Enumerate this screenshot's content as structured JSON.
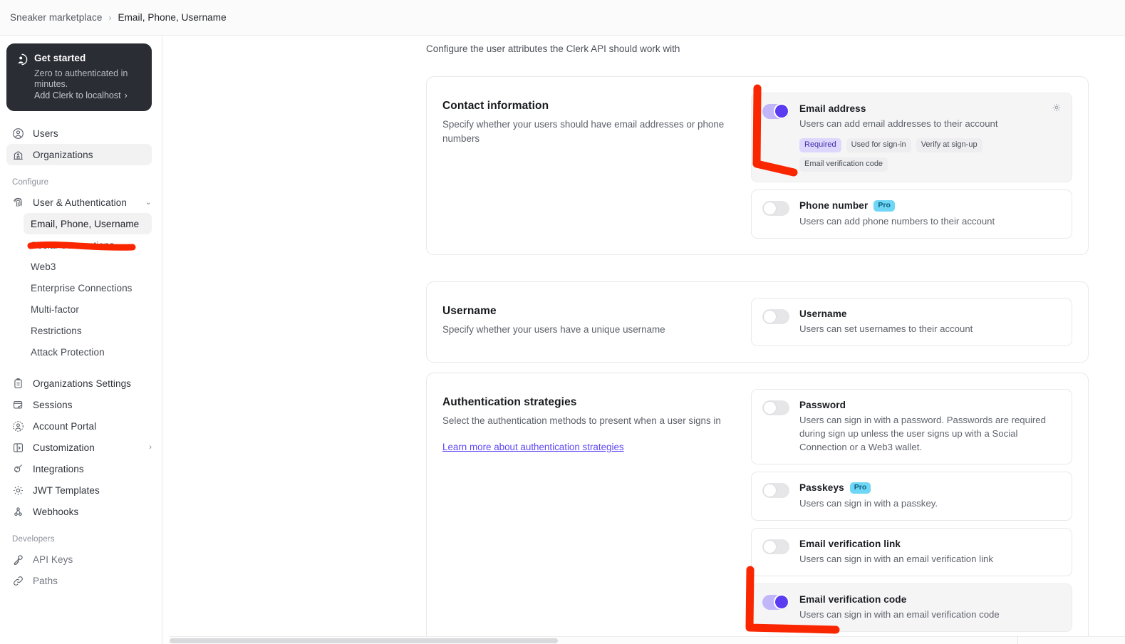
{
  "breadcrumb": {
    "app": "Sneaker marketplace",
    "separator": "›",
    "current": "Email, Phone, Username"
  },
  "sidebar": {
    "get_started": {
      "icon": "user-circle-icon",
      "title": "Get started",
      "subtitle": "Zero to authenticated in minutes.",
      "link": "Add Clerk to localhost",
      "link_chevron": "›"
    },
    "top_items": [
      {
        "icon": "users-icon",
        "label": "Users",
        "active": false
      },
      {
        "icon": "organizations-icon",
        "label": "Organizations",
        "active": true
      }
    ],
    "configure_label": "Configure",
    "configure_group": {
      "icon": "fingerprint-icon",
      "label": "User & Authentication",
      "chevron": "⌄"
    },
    "configure_subitems": [
      {
        "label": "Email, Phone, Username",
        "active": true
      },
      {
        "label": "Social Connections",
        "active": false
      },
      {
        "label": "Web3",
        "active": false
      },
      {
        "label": "Enterprise Connections",
        "active": false
      },
      {
        "label": "Multi-factor",
        "active": false
      },
      {
        "label": "Restrictions",
        "active": false
      },
      {
        "label": "Attack Protection",
        "active": false
      }
    ],
    "configure_items": [
      {
        "icon": "clipboard-icon",
        "label": "Organizations Settings",
        "chevron": ""
      },
      {
        "icon": "sessions-icon",
        "label": "Sessions",
        "chevron": ""
      },
      {
        "icon": "account-portal-icon",
        "label": "Account Portal",
        "chevron": ""
      },
      {
        "icon": "customization-icon",
        "label": "Customization",
        "chevron": "›"
      },
      {
        "icon": "plug-icon",
        "label": "Integrations",
        "chevron": ""
      },
      {
        "icon": "gear-icon",
        "label": "JWT Templates",
        "chevron": ""
      },
      {
        "icon": "webhooks-icon",
        "label": "Webhooks",
        "chevron": ""
      }
    ],
    "developers_label": "Developers",
    "developer_items": [
      {
        "icon": "key-icon",
        "label": "API Keys"
      },
      {
        "icon": "paths-icon",
        "label": "Paths"
      }
    ]
  },
  "main": {
    "intro": "Configure the user attributes the Clerk API should work with",
    "cards": [
      {
        "title": "Contact information",
        "description": "Specify whether your users should have email addresses or phone numbers",
        "link": "",
        "options": [
          {
            "label": "Email address",
            "description": "Users can add email addresses to their account",
            "enabled": true,
            "pro": false,
            "gear": true,
            "chips": [
              {
                "text": "Required",
                "primary": true
              },
              {
                "text": "Used for sign-in",
                "primary": false
              },
              {
                "text": "Verify at sign-up",
                "primary": false
              },
              {
                "text": "Email verification code",
                "primary": false
              }
            ]
          },
          {
            "label": "Phone number",
            "description": "Users can add phone numbers to their account",
            "enabled": false,
            "pro": true,
            "pro_label": "Pro",
            "gear": false,
            "chips": []
          }
        ]
      },
      {
        "title": "Username",
        "description": "Specify whether your users have a unique username",
        "link": "",
        "options": [
          {
            "label": "Username",
            "description": "Users can set usernames to their account",
            "enabled": false,
            "pro": false,
            "gear": false,
            "chips": []
          }
        ]
      },
      {
        "title": "Authentication strategies",
        "description": "Select the authentication methods to present when a user signs in",
        "link": "Learn more about authentication strategies",
        "options": [
          {
            "label": "Password",
            "description": "Users can sign in with a password. Passwords are required during sign up unless the user signs up with a Social Connection or a Web3 wallet.",
            "enabled": false,
            "pro": false,
            "gear": false,
            "chips": []
          },
          {
            "label": "Passkeys",
            "description": "Users can sign in with a passkey.",
            "enabled": false,
            "pro": true,
            "pro_label": "Pro",
            "gear": false,
            "chips": []
          },
          {
            "label": "Email verification link",
            "description": "Users can sign in with an email verification link",
            "enabled": false,
            "pro": false,
            "gear": false,
            "chips": []
          },
          {
            "label": "Email verification code",
            "description": "Users can sign in with an email verification code",
            "enabled": true,
            "pro": false,
            "gear": false,
            "chips": []
          }
        ]
      }
    ]
  },
  "colors": {
    "accent": "#5b3cf0",
    "accent_track": "#c2b6fb",
    "pro_badge_bg": "#6fd7f5",
    "pro_badge_text": "#0b5f7d",
    "chip_primary_bg": "#ded7fd",
    "chip_primary_text": "#3f2fa8",
    "annotation_red": "#fa2600",
    "link": "#5b47f5",
    "get_started_bg": "#2a2d33"
  }
}
